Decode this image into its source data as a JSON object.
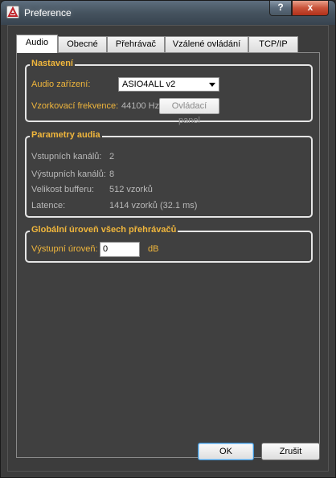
{
  "window": {
    "title": "Preference",
    "help_label": "?",
    "close_label": "x"
  },
  "tabs": [
    {
      "label": "Audio",
      "active": true
    },
    {
      "label": "Obecné",
      "active": false
    },
    {
      "label": "Přehrávač",
      "active": false
    },
    {
      "label": "Vzálené ovládání",
      "active": false
    },
    {
      "label": "TCP/IP",
      "active": false
    }
  ],
  "settings": {
    "title": "Nastavení",
    "device_label": "Audio zařízení:",
    "device_value": "ASIO4ALL v2",
    "sample_rate_label": "Vzorkovací frekvence:",
    "sample_rate_value": "44100 Hz",
    "control_panel_label": "Ovládací panel"
  },
  "audio_params": {
    "title": "Parametry audia",
    "input_channels_label": "Vstupních kanálů:",
    "input_channels_value": "2",
    "output_channels_label": "Výstupních kanálů:",
    "output_channels_value": "8",
    "buffer_size_label": "Velikost bufferu:",
    "buffer_size_value": "512 vzorků",
    "latency_label": "Latence:",
    "latency_value": "1414 vzorků (32.1 ms)"
  },
  "global_level": {
    "title": "Globální úroveň všech přehrávačů",
    "output_level_label": "Výstupní úroveň:",
    "output_level_value": "0",
    "unit": "dB"
  },
  "buttons": {
    "ok_label": "OK",
    "cancel_label": "Zrušit"
  },
  "colors": {
    "accent_label": "#f0b63c",
    "dim_label": "#b8b8b8",
    "panel_bg": "#404040"
  }
}
